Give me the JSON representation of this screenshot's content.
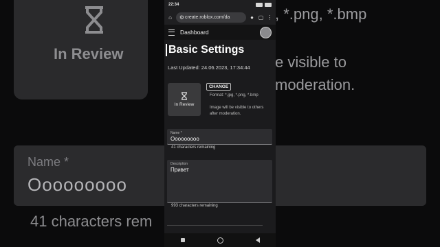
{
  "background": {
    "review_label": "In Review",
    "format_fragment": ", *.png, *.bmp",
    "visible_fragment_1": "e visible to",
    "visible_fragment_2": "moderation.",
    "name_label": "Name *",
    "name_value": "Ooooooooo",
    "remaining_fragment": "41 characters rem"
  },
  "status_bar": {
    "time": "22:34"
  },
  "browser": {
    "url": "create.roblox.com/da"
  },
  "topnav": {
    "title": "Dashboard"
  },
  "page": {
    "title": "Basic Settings",
    "last_updated": "Last Updated: 24.06.2023, 17:34:44"
  },
  "image_panel": {
    "status_label": "In Review",
    "change_button": "CHANGE",
    "format_text": "Format: *.jpg, *.png, *.bmp",
    "visibility_text": "Image will be visible to others after moderation."
  },
  "name_field": {
    "label": "Name *",
    "value": "Ooooooooo",
    "remaining": "41 characters remaining"
  },
  "description_field": {
    "label": "Description",
    "value": "Привет",
    "remaining": "993 characters remaining"
  },
  "colors": {
    "page_bg": "#0b0b0c",
    "phone_bg": "#1b1b1d",
    "field_bg": "#2d2d30"
  }
}
